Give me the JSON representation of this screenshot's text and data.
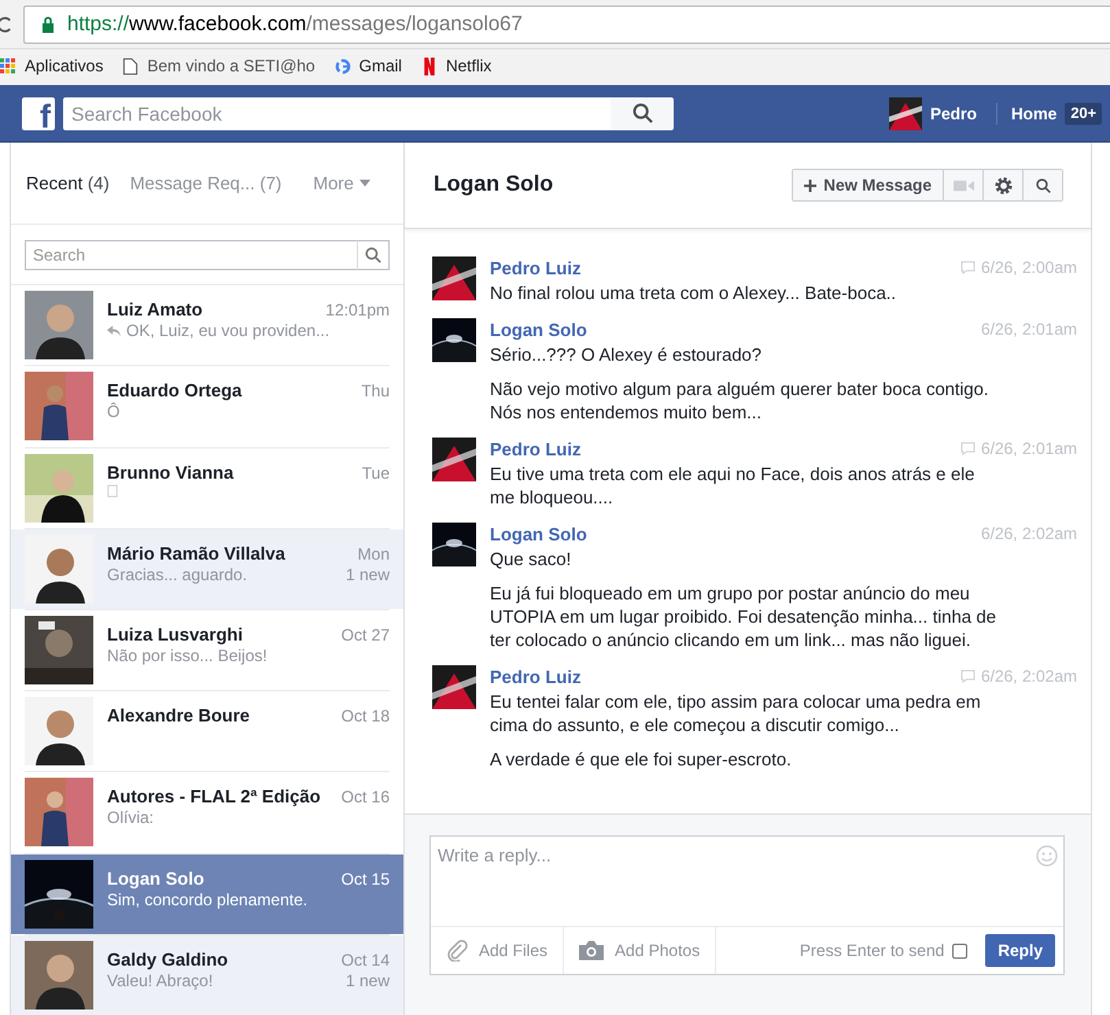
{
  "browser": {
    "url_secure": "https://",
    "url_domain": "www.facebook.com",
    "url_path": "/messages/logansolo67",
    "bookmarks": [
      {
        "kind": "apps",
        "label": "Aplicativos"
      },
      {
        "kind": "page",
        "label": "Bem vindo a SETI@ho"
      },
      {
        "kind": "google",
        "label": "Gmail"
      },
      {
        "kind": "netflix",
        "label": "Netflix"
      }
    ]
  },
  "topbar": {
    "logo": "f",
    "search": {
      "placeholder": "Search Facebook"
    },
    "user": "Pedro",
    "home": "Home",
    "home_badge": "20+"
  },
  "left": {
    "tabs": [
      {
        "label": "Recent",
        "count": "(4)",
        "selected": true
      },
      {
        "label": "Message Req...",
        "count": "(7)",
        "selected": false
      }
    ],
    "more": "More",
    "search": {
      "placeholder": "Search"
    },
    "conversations": [
      {
        "name": "Luiz Amato",
        "time": "12:01pm",
        "preview": "OK, Luiz, eu vou providen...",
        "replied": true,
        "unread": false,
        "selected": false
      },
      {
        "name": "Eduardo Ortega",
        "time": "Thu",
        "preview": "Ô",
        "replied": false,
        "unread": false,
        "selected": false
      },
      {
        "name": "Brunno Vianna",
        "time": "Tue",
        "replied": false,
        "unread": false,
        "selected": false,
        "placeholder_glyph": true
      },
      {
        "name": "Mário Ramão Villalva",
        "time": "Mon",
        "preview": "Gracias... aguardo.",
        "replied": false,
        "unread": true,
        "new_label": "1 new",
        "selected": false
      },
      {
        "name": "Luiza Lusvarghi",
        "time": "Oct 27",
        "preview": "Não por isso... Beijos!",
        "replied": false,
        "unread": false,
        "selected": false
      },
      {
        "name": "Alexandre Boure",
        "time": "Oct 18",
        "replied": false,
        "unread": false,
        "selected": false
      },
      {
        "name": "Autores - FLAL 2ª Edição",
        "time": "Oct 16",
        "preview": "Olívia:",
        "replied": false,
        "unread": false,
        "selected": false
      },
      {
        "name": "Logan Solo",
        "time": "Oct 15",
        "preview": "Sim, concordo plenamente.",
        "replied": false,
        "unread": false,
        "selected": true
      },
      {
        "name": "Galdy Galdino",
        "time": "Oct 14",
        "preview": "Valeu! Abraço!",
        "replied": false,
        "unread": true,
        "new_label": "1 new",
        "selected": false
      }
    ]
  },
  "chat": {
    "title": "Logan Solo",
    "new_message": "New Message",
    "messages": [
      {
        "sender": "Pedro Luiz",
        "time": "6/26, 2:00am",
        "seen": true,
        "paragraphs": [
          "No final rolou uma treta com o Alexey... Bate-boca.."
        ]
      },
      {
        "sender": "Logan Solo",
        "time": "6/26, 2:01am",
        "seen": false,
        "paragraphs": [
          "Sério...??? O Alexey é estourado?",
          "Não vejo motivo algum para alguém querer bater boca contigo. Nós nos entendemos muito bem..."
        ]
      },
      {
        "sender": "Pedro Luiz",
        "time": "6/26, 2:01am",
        "seen": true,
        "paragraphs": [
          "Eu tive uma treta com ele aqui no Face, dois anos atrás e ele me bloqueou...."
        ]
      },
      {
        "sender": "Logan Solo",
        "time": "6/26, 2:02am",
        "seen": false,
        "paragraphs": [
          "Que saco!",
          "Eu já fui bloqueado em um grupo por postar anúncio do meu UTOPIA em um lugar proibido. Foi desatenção minha... tinha de ter colocado o anúncio clicando em um link... mas não liguei."
        ]
      },
      {
        "sender": "Pedro Luiz",
        "time": "6/26, 2:02am",
        "seen": true,
        "paragraphs": [
          "Eu tentei falar com ele, tipo assim para colocar uma pedra em cima do assunto, e ele começou a discutir comigo...",
          "A verdade é que ele foi super-escroto."
        ]
      }
    ],
    "composer": {
      "placeholder": "Write a reply...",
      "add_files": "Add Files",
      "add_photos": "Add Photos",
      "enter_label": "Press Enter to send",
      "enter_checked": false,
      "reply": "Reply"
    }
  }
}
